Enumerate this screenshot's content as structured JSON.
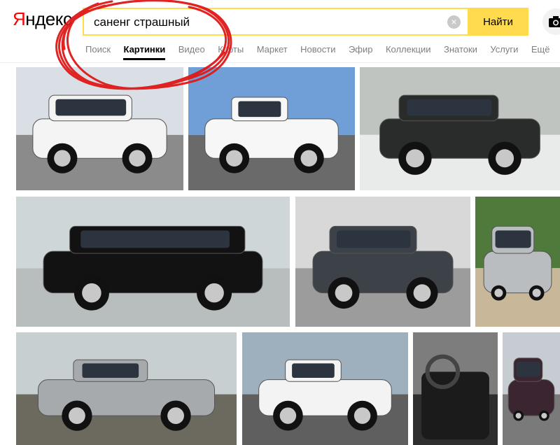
{
  "header": {
    "logo_first": "Я",
    "logo_rest": "ндекс",
    "search_value": "саненг страшный",
    "clear_symbol": "×",
    "find_label": "Найти"
  },
  "tabs": [
    {
      "label": "Поиск",
      "active": false
    },
    {
      "label": "Картинки",
      "active": true
    },
    {
      "label": "Видео",
      "active": false
    },
    {
      "label": "Карты",
      "active": false
    },
    {
      "label": "Маркет",
      "active": false
    },
    {
      "label": "Новости",
      "active": false
    },
    {
      "label": "Эфир",
      "active": false
    },
    {
      "label": "Коллекции",
      "active": false
    },
    {
      "label": "Знатоки",
      "active": false
    },
    {
      "label": "Услуги",
      "active": false
    },
    {
      "label": "Ещё",
      "active": false
    }
  ],
  "results": [
    {
      "id": "white-actyon-sports-wagon",
      "car": "#f4f4f4",
      "sky": "#d9dfe5",
      "ground": "#8b8b8b",
      "kind": "suv"
    },
    {
      "id": "white-actyon-pickup-sea",
      "car": "#f7f7f7",
      "sky": "#6f9fd6",
      "ground": "#6a6a6a",
      "kind": "pickup"
    },
    {
      "id": "black-damaged-rexton-snow",
      "car": "#2a2c2c",
      "sky": "#bfc4c0",
      "ground": "#e9eaea",
      "kind": "suv"
    },
    {
      "id": "black-stavic-minivan",
      "car": "#121212",
      "sky": "#cfd6d8",
      "ground": "#b8bdbe",
      "kind": "van"
    },
    {
      "id": "gray-kyron-showroom",
      "car": "#3c4247",
      "sky": "#d8d8d8",
      "ground": "#9c9c9c",
      "kind": "suv"
    },
    {
      "id": "silver-rexton-greenery",
      "car": "#b9bdc0",
      "sky": "#4f7a3b",
      "ground": "#c9b79a",
      "kind": "suv"
    },
    {
      "id": "silver-actyon-pickup-junk",
      "car": "#a7aaad",
      "sky": "#c7cfd1",
      "ground": "#6c6a5f",
      "kind": "pickup"
    },
    {
      "id": "white-actyon-pickup-street",
      "car": "#f3f3f3",
      "sky": "#9eb0bd",
      "ground": "#5f5f5f",
      "kind": "pickup"
    },
    {
      "id": "black-interior-seats",
      "car": "#1b1b1b",
      "sky": "#7d7d7d",
      "ground": "#2e2e2e",
      "kind": "interior"
    },
    {
      "id": "burgundy-kyron-partial",
      "car": "#3b2530",
      "sky": "#c6ccd1",
      "ground": "#7a7a7a",
      "kind": "suv"
    }
  ],
  "annotation_color": "#e01818"
}
